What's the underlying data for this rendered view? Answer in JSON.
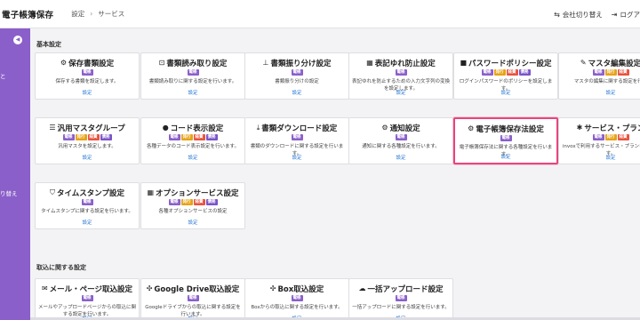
{
  "header": {
    "app_title": "電子帳簿保存",
    "breadcrumb": [
      "設定",
      "サービス"
    ],
    "actions": [
      {
        "label": "会社切り替え",
        "icon": "switch-icon",
        "glyph": "⇆"
      },
      {
        "label": "ログア",
        "icon": "logout-icon",
        "glyph": "⇥"
      }
    ]
  },
  "sidebar": {
    "color": "#8b5fc9",
    "toggle_glyph": "◀",
    "labels": [
      "と",
      "り替え"
    ]
  },
  "badge_colors": {
    "電帳": "#8b5fc9",
    "発行": "#e6a317",
    "経費": "#e8533f",
    "債務": "#7a54c7"
  },
  "sections": [
    {
      "title": "基本設定",
      "cards": [
        {
          "title": "保存書類設定",
          "icon": "gear-icon",
          "glyph": "⚙",
          "badges": [
            "電帳"
          ],
          "desc": "保存する書類を設定します。",
          "link": "設定"
        },
        {
          "title": "書類読み取り設定",
          "icon": "scan-icon",
          "glyph": "⊡",
          "badges": [
            "電帳"
          ],
          "desc": "書類読み取りに関する設定を行います。",
          "link": "設定"
        },
        {
          "title": "書類振り分け設定",
          "icon": "sitemap-icon",
          "glyph": "⊥",
          "badges": [
            "電帳"
          ],
          "desc": "書類振り分けの設定",
          "link": "設定"
        },
        {
          "title": "表記ゆれ防止設定",
          "icon": "building-icon",
          "glyph": "▦",
          "badges": [
            "電帳"
          ],
          "desc": "表記ゆれを防止するための入力文字列の変換を設定します。",
          "link": "設定"
        },
        {
          "title": "パスワードポリシー設定",
          "icon": "lock-icon",
          "glyph": "■",
          "badges": [
            "電帳",
            "発行",
            "経費",
            "債務"
          ],
          "desc": "ログインパスワードのポリシーを設定します。",
          "link": "設定"
        },
        {
          "title": "マスタ編集設定",
          "icon": "edit-icon",
          "glyph": "✎",
          "badges": [
            "電帳",
            "発行",
            "経費"
          ],
          "desc": "マスタの編集に関する設定を行い",
          "link": "設定"
        },
        {
          "title": "汎用マスタグループ",
          "icon": "list-icon",
          "glyph": "☰",
          "badges": [
            "電帳",
            "発行",
            "経費",
            "債務"
          ],
          "desc": "汎用マスタを設定します。",
          "link": "設定"
        },
        {
          "title": "コード表示設定",
          "icon": "ellipsis-icon",
          "glyph": "●",
          "badges": [
            "電帳",
            "発行",
            "経費",
            "債務"
          ],
          "desc": "各種データのコード表示設定を行います。",
          "link": "設定"
        },
        {
          "title": "書類ダウンロード設定",
          "icon": "download-icon",
          "glyph": "⤓",
          "badges": [
            "電帳"
          ],
          "desc": "書類のダウンロードに関する設定を行います。",
          "link": "設定"
        },
        {
          "title": "通知設定",
          "icon": "gear-icon",
          "glyph": "⚙",
          "badges": [
            "電帳"
          ],
          "desc": "通知に関する各種設定を行います。",
          "link": "設定"
        },
        {
          "title": "電子帳簿保存法設定",
          "icon": "gear-icon",
          "glyph": "⚙",
          "badges": [
            "電帳"
          ],
          "desc": "電子帳簿保存法に関する各種設定を行います。",
          "link": "設定",
          "highlight": true
        },
        {
          "title": "サービス・プラン",
          "icon": "star-icon",
          "glyph": "✱",
          "badges": [
            "電帳",
            "発行",
            "経費"
          ],
          "desc": "invoxで利用するサービス・プランを行います。",
          "link": "設定"
        },
        {
          "title": "タイムスタンプ設定",
          "icon": "shield-icon",
          "glyph": "⛉",
          "badges": [
            "電帳"
          ],
          "desc": "タイムスタンプに関する設定を行います。",
          "link": "設定"
        },
        {
          "title": "オプションサービス設定",
          "icon": "grid-icon",
          "glyph": "▦",
          "badges": [
            "電帳",
            "発行",
            "経費",
            "債務"
          ],
          "desc": "各種オプションサービスの設定",
          "link": "設定"
        }
      ]
    },
    {
      "title": "取込に関する設定",
      "cards": [
        {
          "title": "メール・ページ取込設定",
          "icon": "mail-icon",
          "glyph": "✉",
          "badges": [
            "電帳"
          ],
          "desc": "メールやアップロードページからの取込に関する設定を行います。",
          "link": "設定"
        },
        {
          "title": "Google Drive取込設定",
          "icon": "sync-icon",
          "glyph": "✣",
          "badges": [
            "電帳"
          ],
          "desc": "Googleドライブからの取込に関する設定を行います。",
          "link": "設定"
        },
        {
          "title": "Box取込設定",
          "icon": "sync-icon",
          "glyph": "✣",
          "badges": [
            "電帳"
          ],
          "desc": "Boxからの取込に関する設定を行います。",
          "link": "設定"
        },
        {
          "title": "一括アップロード設定",
          "icon": "cloud-upload-icon",
          "glyph": "☁",
          "badges": [
            "電帳"
          ],
          "desc": "一括アップロードに関する設定を行います。",
          "link": "設定"
        }
      ]
    }
  ]
}
